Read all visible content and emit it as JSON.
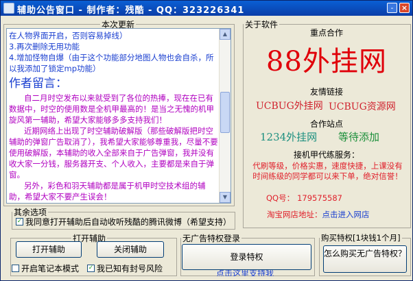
{
  "title": "辅助公告窗口 - 制作者：残酷 - QQ：323226341",
  "titlebar_buttons": {
    "minimize": "-",
    "close": "×"
  },
  "news": {
    "legend": "本次更新",
    "lines": [
      "在人物界面开启，否则容易掉线）",
      "3.再次删除无用功能",
      "4.增加怪物自爆（由于这个功能部分地图人物也会自杀，所以我添加了锁定mp功能）"
    ],
    "author_heading": "作者留言：",
    "paragraphs": [
      "自二月时空发布以来就受到了各位的热捧，现在在已有数据中，时空的使用数是全机甲最高的！是当之无愧的机甲旋风第一辅助，希望大家能够多多支持我们！",
      "近期网络上出现了时空辅助破解版（那些破解版把时空辅助的弹窗广告取消了），我希望大家能够尊重我，尽量不要使用破解版，本辅助的收入全部来自于广告弹窗，我并没有收大家一分钱，服务器开支、个人收入，主要都是来自于弹窗。",
      "另外，彩色和羽天辅助都是属于机甲时空技术组的辅助，希望大家不要产生误会！"
    ]
  },
  "other_options": {
    "legend": "其余选项",
    "agree_checkbox": {
      "label": "我同意打开辅助后自动收听残酷的腾讯微博（希望支持）",
      "checked": true
    }
  },
  "open_assist": {
    "legend": "打开辅助",
    "open_button": "打开辅助",
    "close_button": "关闭辅助",
    "notebook_checkbox": {
      "label": "开启笔记本模式",
      "checked": false
    },
    "risk_checkbox": {
      "label": "我已知有封号风险",
      "checked": true
    }
  },
  "about": {
    "legend": "关于软件",
    "partner_header": "重点合作",
    "partner_name": "88外挂网",
    "links_header": "友情链接",
    "links": [
      "UCBUG外挂网",
      "UCBUG资源网"
    ],
    "sites_header": "合作站点",
    "sites": [
      "1234外挂网",
      "等待添加"
    ],
    "agent_header": "接机甲代练服务：",
    "agent_text": "代刷等级，价格实惠，速度快捷，上课没有时间练级的同学都可以来下单，绝对信誉！",
    "qq_label": "QQ号：",
    "qq_value": "179575587",
    "shop_label": "淘宝网店地址：",
    "shop_link": "点击进入网店"
  },
  "ad_free": {
    "legend": "无广告特权登录",
    "login_button": "登录特权",
    "below_link": "点击这里支持我"
  },
  "buy": {
    "legend": "购买特权[1块钱1个月]",
    "button": "怎么购买无广告特权？"
  },
  "colors": {
    "title_bg": "#0b4fc4",
    "accent_red": "#e0000a",
    "link_blue": "#1a3fd0",
    "purple": "#b000c0",
    "teal": "#1b8f7f"
  }
}
